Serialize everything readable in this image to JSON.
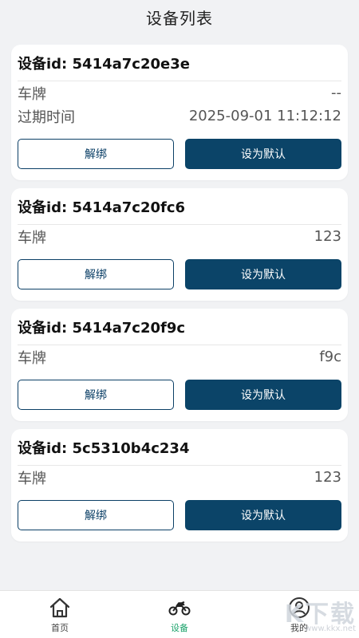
{
  "header": {
    "title": "设备列表"
  },
  "devices": [
    {
      "heading": "设备id: 5414a7c20e3e",
      "rows": [
        {
          "label": "车牌",
          "value": "--"
        },
        {
          "label": "过期时间",
          "value": "2025-09-01 11:12:12"
        }
      ],
      "unbind_label": "解绑",
      "default_label": "设为默认"
    },
    {
      "heading": "设备id: 5414a7c20fc6",
      "rows": [
        {
          "label": "车牌",
          "value": "123"
        }
      ],
      "unbind_label": "解绑",
      "default_label": "设为默认"
    },
    {
      "heading": "设备id: 5414a7c20f9c",
      "rows": [
        {
          "label": "车牌",
          "value": "f9c"
        }
      ],
      "unbind_label": "解绑",
      "default_label": "设为默认"
    },
    {
      "heading": "设备id: 5c5310b4c234",
      "rows": [
        {
          "label": "车牌",
          "value": "123"
        }
      ],
      "unbind_label": "解绑",
      "default_label": "设为默认"
    }
  ],
  "tabbar": {
    "items": [
      {
        "label": "首页",
        "icon": "home-icon"
      },
      {
        "label": "设备",
        "icon": "motorcycle-icon",
        "active": true
      },
      {
        "label": "我的",
        "icon": "user-icon"
      }
    ]
  },
  "watermark": {
    "mark": "K下载",
    "site": "www.kkx.net"
  },
  "colors": {
    "primary": "#0b4468",
    "tab_active": "#1aa26a",
    "background": "#f1f2f4"
  }
}
